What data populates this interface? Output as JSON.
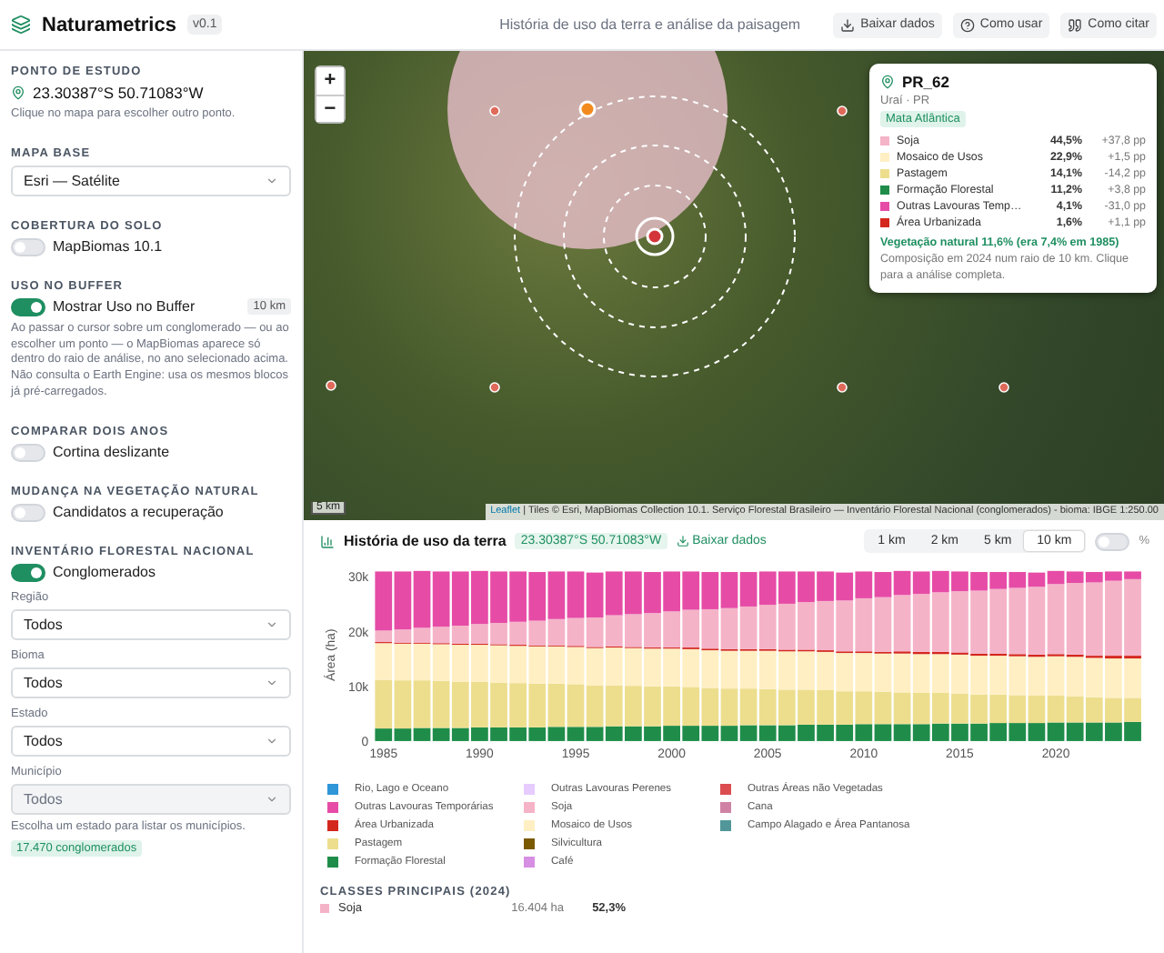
{
  "header": {
    "title": "Naturametrics",
    "version": "v0.1",
    "subtitle": "História de uso da terra e análise da paisagem",
    "buttons": [
      {
        "label": "Baixar dados"
      },
      {
        "label": "Como usar"
      },
      {
        "label": "Como citar"
      }
    ]
  },
  "sidebar": {
    "sections": [
      {
        "kind": "point",
        "heading": "PONTO DE ESTUDO",
        "coords": "23.30387°S 50.71083°W",
        "hint": "Clique no mapa para escolher outro ponto."
      },
      {
        "kind": "select",
        "heading": "MAPA BASE",
        "value": "Esri — Satélite"
      },
      {
        "kind": "toggle",
        "heading": "COBERTURA DO SOLO",
        "label": "MapBiomas 10.1",
        "on": false
      },
      {
        "kind": "toggle",
        "heading": "USO NO BUFFER",
        "label": "Mostrar Uso no Buffer",
        "on": true,
        "badge": "10 km",
        "note": "Ao passar o cursor sobre um conglomerado — ou ao escolher um ponto — o MapBiomas aparece só dentro do raio de análise, no ano selecionado acima. Não consulta o Earth Engine: usa os mesmos blocos já pré-carregados."
      },
      {
        "kind": "toggle",
        "heading": "COMPARAR DOIS ANOS",
        "label": "Cortina deslizante",
        "on": false
      },
      {
        "kind": "toggle",
        "heading": "MUDANÇA NA VEGETAÇÃO NATURAL",
        "label": "Candidatos a recuperação",
        "on": false
      },
      {
        "kind": "inventory",
        "heading": "INVENTÁRIO FLORESTAL NACIONAL",
        "label": "Conglomerados",
        "on": true,
        "filters": [
          {
            "label": "Região",
            "value": "Todos",
            "disabled": false
          },
          {
            "label": "Bioma",
            "value": "Todos",
            "disabled": false
          },
          {
            "label": "Estado",
            "value": "Todos",
            "disabled": false
          },
          {
            "label": "Município",
            "value": "Todos",
            "disabled": true
          }
        ],
        "hint": "Escolha um estado para listar os municípios.",
        "count": "17.470 conglomerados"
      }
    ]
  },
  "map": {
    "zoom_in": "+",
    "zoom_out": "−",
    "scale": "5 km",
    "attribution_link": "Leaflet",
    "attribution": "| Tiles © Esri, MapBiomas Collection 10.1. Serviço Florestal Brasileiro — Inventário Florestal Nacional (conglomerados) - bioma: IBGE 1:250.00",
    "popup": {
      "title": "PR_62",
      "place": "Uraí · PR",
      "biome": "Mata Atlântica",
      "rows": [
        {
          "name": "Soja",
          "share": "44,5%",
          "change": "+37,8 pp",
          "color": "#f5b3c8"
        },
        {
          "name": "Mosaico de Usos",
          "share": "22,9%",
          "change": "+1,5 pp",
          "color": "#ffefc3"
        },
        {
          "name": "Pastagem",
          "share": "14,1%",
          "change": "-14,2 pp",
          "color": "#edde8e"
        },
        {
          "name": "Formação Florestal",
          "share": "11,2%",
          "change": "+3,8 pp",
          "color": "#1f8d49"
        },
        {
          "name": "Outras Lavouras Temp…",
          "share": "4,1%",
          "change": "-31,0 pp",
          "color": "#e64ca6"
        },
        {
          "name": "Área Urbanizada",
          "share": "1,6%",
          "change": "+1,1 pp",
          "color": "#d4271e"
        }
      ],
      "summary": "Vegetação natural 11,6% (era 7,4% em 1985)",
      "note": "Composição em 2024 num raio de 10 km. Clique para a análise completa."
    }
  },
  "history": {
    "title": "História de uso da terra",
    "coords": "23.30387°S 50.71083°W",
    "download": "Baixar dados",
    "radii": [
      {
        "label": "1 km",
        "selected": false
      },
      {
        "label": "2 km",
        "selected": false
      },
      {
        "label": "5 km",
        "selected": false
      },
      {
        "label": "10 km",
        "selected": true
      }
    ],
    "percent_toggle": {
      "label": "%",
      "on": false
    },
    "chart_data": {
      "type": "bar",
      "stacked": true,
      "ylabel": "Área (ha)",
      "ylim": [
        0,
        31500
      ],
      "xlim": [
        1984.5,
        2024.5
      ],
      "x": [
        1985,
        1986,
        1987,
        1988,
        1989,
        1990,
        1991,
        1992,
        1993,
        1994,
        1995,
        1996,
        1997,
        1998,
        1999,
        2000,
        2001,
        2002,
        2003,
        2004,
        2005,
        2006,
        2007,
        2008,
        2009,
        2010,
        2011,
        2012,
        2013,
        2014,
        2015,
        2016,
        2017,
        2018,
        2019,
        2020,
        2021,
        2022,
        2023,
        2024
      ],
      "xticks": [
        1985,
        1990,
        1995,
        2000,
        2005,
        2010,
        2015,
        2020
      ],
      "yticks": [
        {
          "value": 0,
          "label": "0"
        },
        {
          "value": 10000,
          "label": "10k"
        },
        {
          "value": 20000,
          "label": "20k"
        },
        {
          "value": 30000,
          "label": "30k"
        }
      ],
      "series": [
        {
          "name": "Formação Florestal",
          "color": "#1f8d49",
          "values": [
            2300,
            2300,
            2400,
            2400,
            2400,
            2500,
            2500,
            2500,
            2500,
            2600,
            2600,
            2600,
            2700,
            2700,
            2700,
            2800,
            2800,
            2800,
            2800,
            2900,
            2900,
            2900,
            3000,
            3000,
            3000,
            3100,
            3100,
            3100,
            3100,
            3200,
            3200,
            3200,
            3300,
            3300,
            3300,
            3400,
            3400,
            3400,
            3400,
            3500
          ]
        },
        {
          "name": "Pastagem",
          "color": "#edde8e",
          "values": [
            8900,
            8800,
            8700,
            8600,
            8400,
            8300,
            8200,
            8100,
            8000,
            7900,
            7800,
            7600,
            7500,
            7400,
            7300,
            7200,
            7100,
            6900,
            6800,
            6700,
            6600,
            6500,
            6400,
            6300,
            6100,
            6000,
            5900,
            5800,
            5700,
            5600,
            5500,
            5300,
            5200,
            5100,
            5000,
            4900,
            4800,
            4600,
            4500,
            4400
          ]
        },
        {
          "name": "Mosaico de Usos",
          "color": "#ffefc3",
          "values": [
            6700,
            6700,
            6700,
            6700,
            6800,
            6800,
            6800,
            6800,
            6800,
            6800,
            6800,
            6800,
            6900,
            6900,
            6900,
            6900,
            6900,
            6900,
            6900,
            6900,
            7000,
            7000,
            7000,
            7000,
            7000,
            7000,
            7000,
            7100,
            7100,
            7100,
            7100,
            7100,
            7100,
            7100,
            7100,
            7200,
            7200,
            7200,
            7200,
            7200
          ]
        },
        {
          "name": "Área Urbanizada",
          "color": "#d4271e",
          "values": [
            200,
            200,
            200,
            200,
            200,
            200,
            200,
            200,
            200,
            200,
            200,
            200,
            200,
            200,
            200,
            200,
            300,
            300,
            300,
            300,
            300,
            300,
            300,
            300,
            300,
            300,
            300,
            400,
            400,
            400,
            400,
            400,
            400,
            400,
            400,
            400,
            400,
            400,
            500,
            500
          ]
        },
        {
          "name": "Soja",
          "color": "#f5b3c8",
          "values": [
            2100,
            2400,
            2700,
            3000,
            3300,
            3600,
            3900,
            4200,
            4500,
            4800,
            5100,
            5400,
            5700,
            6000,
            6300,
            6600,
            6900,
            7200,
            7500,
            7800,
            8100,
            8400,
            8700,
            9000,
            9300,
            9700,
            10000,
            10300,
            10600,
            10900,
            11200,
            11500,
            11800,
            12100,
            12400,
            12800,
            13100,
            13400,
            13700,
            14000
          ]
        },
        {
          "name": "Outras Lavouras Temporárias",
          "color": "#e64ca6",
          "values": [
            10800,
            10600,
            10400,
            10100,
            9900,
            9700,
            9400,
            9200,
            8900,
            8700,
            8500,
            8200,
            8000,
            7800,
            7500,
            7300,
            7000,
            6800,
            6600,
            6300,
            6100,
            5900,
            5600,
            5400,
            5100,
            4900,
            4600,
            4400,
            4100,
            3900,
            3600,
            3400,
            3100,
            2900,
            2600,
            2400,
            2100,
            1900,
            1700,
            1400
          ]
        },
        {
          "name": "Rio, Lago e Oceano",
          "color": "#2f96d8",
          "values": [
            0,
            0,
            0,
            0,
            0,
            0,
            0,
            0,
            0,
            0,
            0,
            0,
            0,
            0,
            0,
            0,
            0,
            0,
            0,
            0,
            0,
            0,
            0,
            0,
            0,
            0,
            0,
            0,
            0,
            0,
            0,
            0,
            0,
            0,
            0,
            0,
            0,
            0,
            0,
            0
          ]
        },
        {
          "name": "Outras Lavouras Perenes",
          "color": "#e6ccff",
          "values": [
            0,
            0,
            0,
            0,
            0,
            0,
            0,
            0,
            0,
            0,
            0,
            0,
            0,
            0,
            0,
            0,
            0,
            0,
            0,
            0,
            0,
            0,
            0,
            0,
            0,
            0,
            0,
            0,
            0,
            0,
            0,
            0,
            0,
            0,
            0,
            0,
            0,
            0,
            0,
            0
          ]
        },
        {
          "name": "Silvicultura",
          "color": "#7a5900",
          "values": [
            0,
            0,
            0,
            0,
            0,
            0,
            0,
            0,
            0,
            0,
            0,
            0,
            0,
            0,
            0,
            0,
            0,
            0,
            0,
            0,
            0,
            0,
            0,
            0,
            0,
            0,
            0,
            0,
            0,
            0,
            0,
            0,
            0,
            0,
            0,
            0,
            0,
            0,
            0,
            0
          ]
        },
        {
          "name": "Café",
          "color": "#d68fe2",
          "values": [
            0,
            0,
            0,
            0,
            0,
            0,
            0,
            0,
            0,
            0,
            0,
            0,
            0,
            0,
            0,
            0,
            0,
            0,
            0,
            0,
            0,
            0,
            0,
            0,
            0,
            0,
            0,
            0,
            0,
            0,
            0,
            0,
            0,
            0,
            0,
            0,
            0,
            0,
            0,
            0
          ]
        },
        {
          "name": "Outras Áreas não Vegetadas",
          "color": "#db4d4f",
          "values": [
            0,
            0,
            0,
            0,
            0,
            0,
            0,
            0,
            0,
            0,
            0,
            0,
            0,
            0,
            0,
            0,
            0,
            0,
            0,
            0,
            0,
            0,
            0,
            0,
            0,
            0,
            0,
            0,
            0,
            0,
            0,
            0,
            0,
            0,
            0,
            0,
            0,
            0,
            0,
            0
          ]
        },
        {
          "name": "Cana",
          "color": "#d082a5",
          "values": [
            0,
            0,
            0,
            0,
            0,
            0,
            0,
            0,
            0,
            0,
            0,
            0,
            0,
            0,
            0,
            0,
            0,
            0,
            0,
            0,
            0,
            0,
            0,
            0,
            0,
            0,
            0,
            0,
            0,
            0,
            0,
            0,
            0,
            0,
            0,
            0,
            0,
            0,
            0,
            0
          ]
        },
        {
          "name": "Campo Alagado e Área Pantanosa",
          "color": "#519799",
          "values": [
            0,
            0,
            0,
            0,
            0,
            0,
            0,
            0,
            0,
            0,
            0,
            0,
            0,
            0,
            0,
            0,
            0,
            0,
            0,
            0,
            0,
            0,
            0,
            0,
            0,
            0,
            0,
            0,
            0,
            0,
            0,
            0,
            0,
            0,
            0,
            0,
            0,
            0,
            0,
            0
          ]
        }
      ]
    },
    "classes": {
      "heading": "CLASSES PRINCIPAIS (2024)",
      "rows": [
        {
          "name": "Soja",
          "area": "16.404 ha",
          "share": "52,3%",
          "color": "#f5b3c8"
        }
      ]
    }
  }
}
